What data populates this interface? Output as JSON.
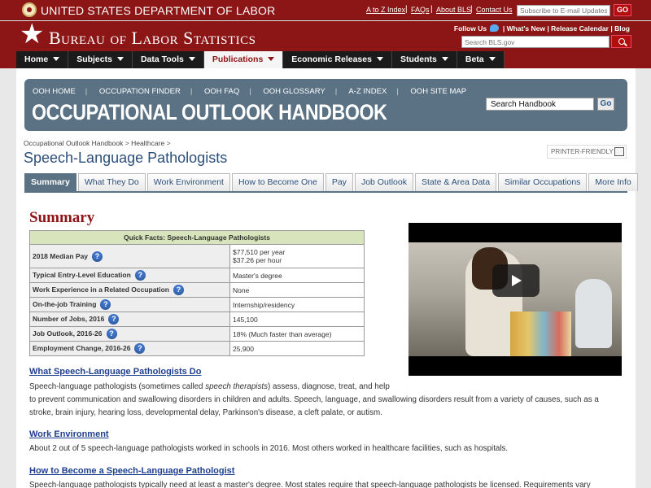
{
  "dol": {
    "title": "UNITED STATES DEPARTMENT OF LABOR",
    "links": [
      "A to Z Index",
      "FAQs",
      "About BLS",
      "Contact Us"
    ],
    "email_placeholder": "Subscribe to E-mail Updates",
    "go_label": "GO"
  },
  "bls": {
    "title": "Bureau of Labor Statistics",
    "follow_us": "Follow Us",
    "whats_new": "What's New",
    "release_calendar": "Release Calendar",
    "blog": "Blog",
    "search_placeholder": "Search BLS.gov"
  },
  "nav": {
    "items": [
      "Home",
      "Subjects",
      "Data Tools",
      "Publications",
      "Economic Releases",
      "Students",
      "Beta"
    ],
    "active": "Publications"
  },
  "ooh": {
    "links": [
      "OOH HOME",
      "OCCUPATION FINDER",
      "OOH FAQ",
      "OOH GLOSSARY",
      "A-Z INDEX",
      "OOH SITE MAP"
    ],
    "title": "OCCUPATIONAL OUTLOOK HANDBOOK",
    "search_value": "Search Handbook",
    "go_label": "Go"
  },
  "breadcrumb": [
    "Occupational Outlook Handbook",
    "Healthcare"
  ],
  "page_title": "Speech-Language Pathologists",
  "printer_label": "PRINTER-FRIENDLY",
  "tabs": [
    "Summary",
    "What They Do",
    "Work Environment",
    "How to Become One",
    "Pay",
    "Job Outlook",
    "State & Area Data",
    "Similar Occupations",
    "More Info"
  ],
  "summary": {
    "heading": "Summary",
    "facts_title": "Quick Facts: Speech-Language Pathologists",
    "facts": [
      {
        "label": "2018 Median Pay",
        "value": "$77,510 per year",
        "value2": "$37.26 per hour"
      },
      {
        "label": "Typical Entry-Level Education",
        "value": "Master's degree"
      },
      {
        "label": "Work Experience in a Related Occupation",
        "value": "None"
      },
      {
        "label": "On-the-job Training",
        "value": "Internship/residency"
      },
      {
        "label": "Number of Jobs, 2016",
        "value": "145,100"
      },
      {
        "label": "Job Outlook, 2016-26",
        "value": "18% (Much faster than average)"
      },
      {
        "label": "Employment Change, 2016-26",
        "value": "25,900"
      }
    ]
  },
  "sections": [
    {
      "heading": "What Speech-Language Pathologists Do",
      "text_before": "Speech-language pathologists (sometimes called ",
      "text_italic": "speech therapists",
      "text_after": ") assess, diagnose, treat, and help",
      "text_line2": "to prevent communication and swallowing disorders in children and adults. Speech, language, and swallowing disorders result from a variety of causes, such as a stroke, brain injury, hearing loss, developmental delay, Parkinson's disease, a cleft palate, or autism."
    },
    {
      "heading": "Work Environment",
      "text": "About 2 out of 5 speech-language pathologists worked in schools in 2016. Most others worked in healthcare facilities, such as hospitals."
    },
    {
      "heading": "How to Become a Speech-Language Pathologist",
      "text": "Speech-language pathologists typically need at least a master's degree. Most states require that speech-language pathologists be licensed. Requirements vary"
    }
  ],
  "colors": {
    "brand_red": "#8c1515",
    "ooh_banner": "#5a7283",
    "heading_red": "#8c1515",
    "link_blue": "#1f3f8f",
    "facts_header": "#d8e4bc"
  }
}
